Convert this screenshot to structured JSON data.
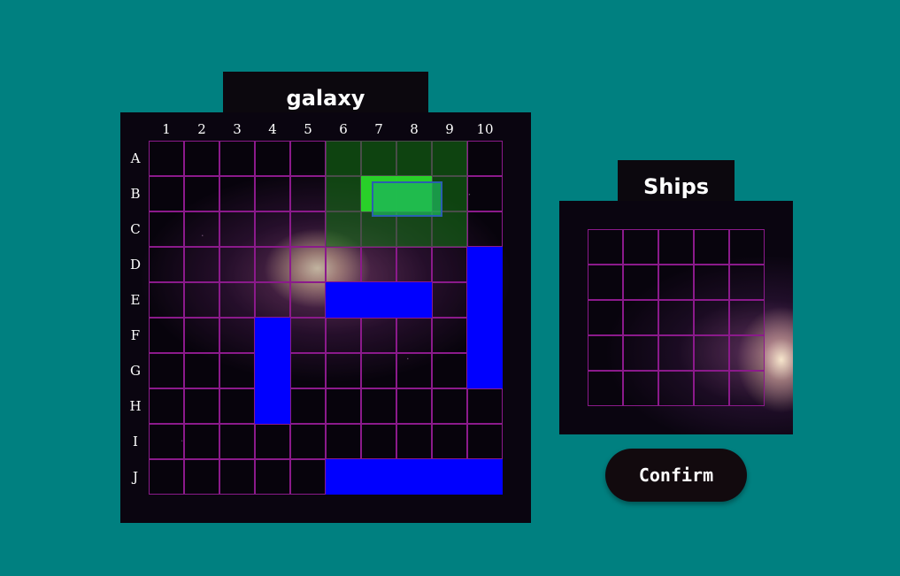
{
  "board": {
    "title": "galaxy",
    "columns": [
      "1",
      "2",
      "3",
      "4",
      "5",
      "6",
      "7",
      "8",
      "9",
      "10"
    ],
    "rows": [
      "A",
      "B",
      "C",
      "D",
      "E",
      "F",
      "G",
      "H",
      "I",
      "J"
    ],
    "ships": [
      {
        "name": "ship-vertical-d10-g10",
        "orientation": "vertical",
        "start": "D10",
        "length": 4
      },
      {
        "name": "ship-horizontal-e6-e8",
        "orientation": "horizontal",
        "start": "E6",
        "length": 3
      },
      {
        "name": "ship-vertical-f4-h4",
        "orientation": "vertical",
        "start": "F4",
        "length": 3
      },
      {
        "name": "ship-horizontal-j6-j10",
        "orientation": "horizontal",
        "start": "J6",
        "length": 5
      }
    ],
    "placement_preview": {
      "zone": "A6-C9",
      "ship_cells": [
        "B7",
        "B8"
      ]
    },
    "ship_color": "#0000ff",
    "grid_line_color": "#8b1a8b"
  },
  "ships_panel": {
    "title": "Ships",
    "size": "5x5"
  },
  "confirm": {
    "label": "Confirm"
  },
  "colors": {
    "background": "#008080",
    "preview_ship": "#2ad82a"
  }
}
